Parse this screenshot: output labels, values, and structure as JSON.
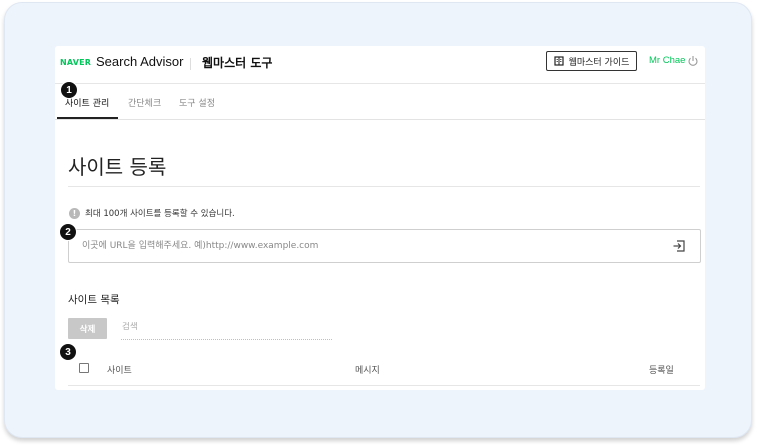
{
  "header": {
    "logo": "NAVER",
    "brand": "Search Advisor",
    "tool_title": "웹마스터 도구",
    "guide_button": "웹마스터 가이드",
    "user": "Mr Chae"
  },
  "tabs": [
    {
      "label": "사이트 관리",
      "active": true
    },
    {
      "label": "간단체크",
      "active": false
    },
    {
      "label": "도구 설정",
      "active": false
    }
  ],
  "page": {
    "title": "사이트 등록",
    "notice": "최대 100개 사이트를 등록할 수 있습니다.",
    "url_placeholder": "이곳에 URL을 입력해주세요. 예)http://www.example.com"
  },
  "site_list": {
    "title": "사이트 목록",
    "delete_button": "삭제",
    "search_placeholder": "검색",
    "columns": [
      "사이트",
      "메시지",
      "등록일"
    ]
  },
  "badges": [
    "1",
    "2",
    "3"
  ],
  "colors": {
    "accent": "#03c75a",
    "frame_bg": "#eef4fc",
    "badge": "#111111"
  }
}
